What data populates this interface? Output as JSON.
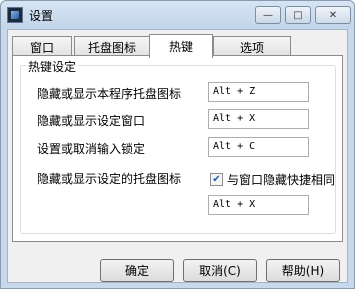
{
  "window": {
    "title": "设置",
    "controls": {
      "minimize": "—",
      "maximize": "□",
      "close": "✕"
    }
  },
  "tabs": [
    {
      "label": "窗口"
    },
    {
      "label": "托盘图标"
    },
    {
      "label": "热键",
      "active": true
    },
    {
      "label": "选项"
    }
  ],
  "hotkeys": {
    "group_title": "热键设定",
    "rows": [
      {
        "label": "隐藏或显示本程序托盘图标",
        "value": "Alt + Z"
      },
      {
        "label": "隐藏或显示设定窗口",
        "value": "Alt + X"
      },
      {
        "label": "设置或取消输入锁定",
        "value": "Alt + C"
      },
      {
        "label": "隐藏或显示设定的托盘图标",
        "value": "Alt + X"
      }
    ],
    "checkbox": {
      "label": "与窗口隐藏快捷相同",
      "checked": true
    }
  },
  "buttons": {
    "ok": "确定",
    "cancel": "取消(C)",
    "help": "帮助(H)"
  },
  "colors": {
    "accent": "#1a5fb4",
    "titlebar": "#c9d9ec"
  }
}
